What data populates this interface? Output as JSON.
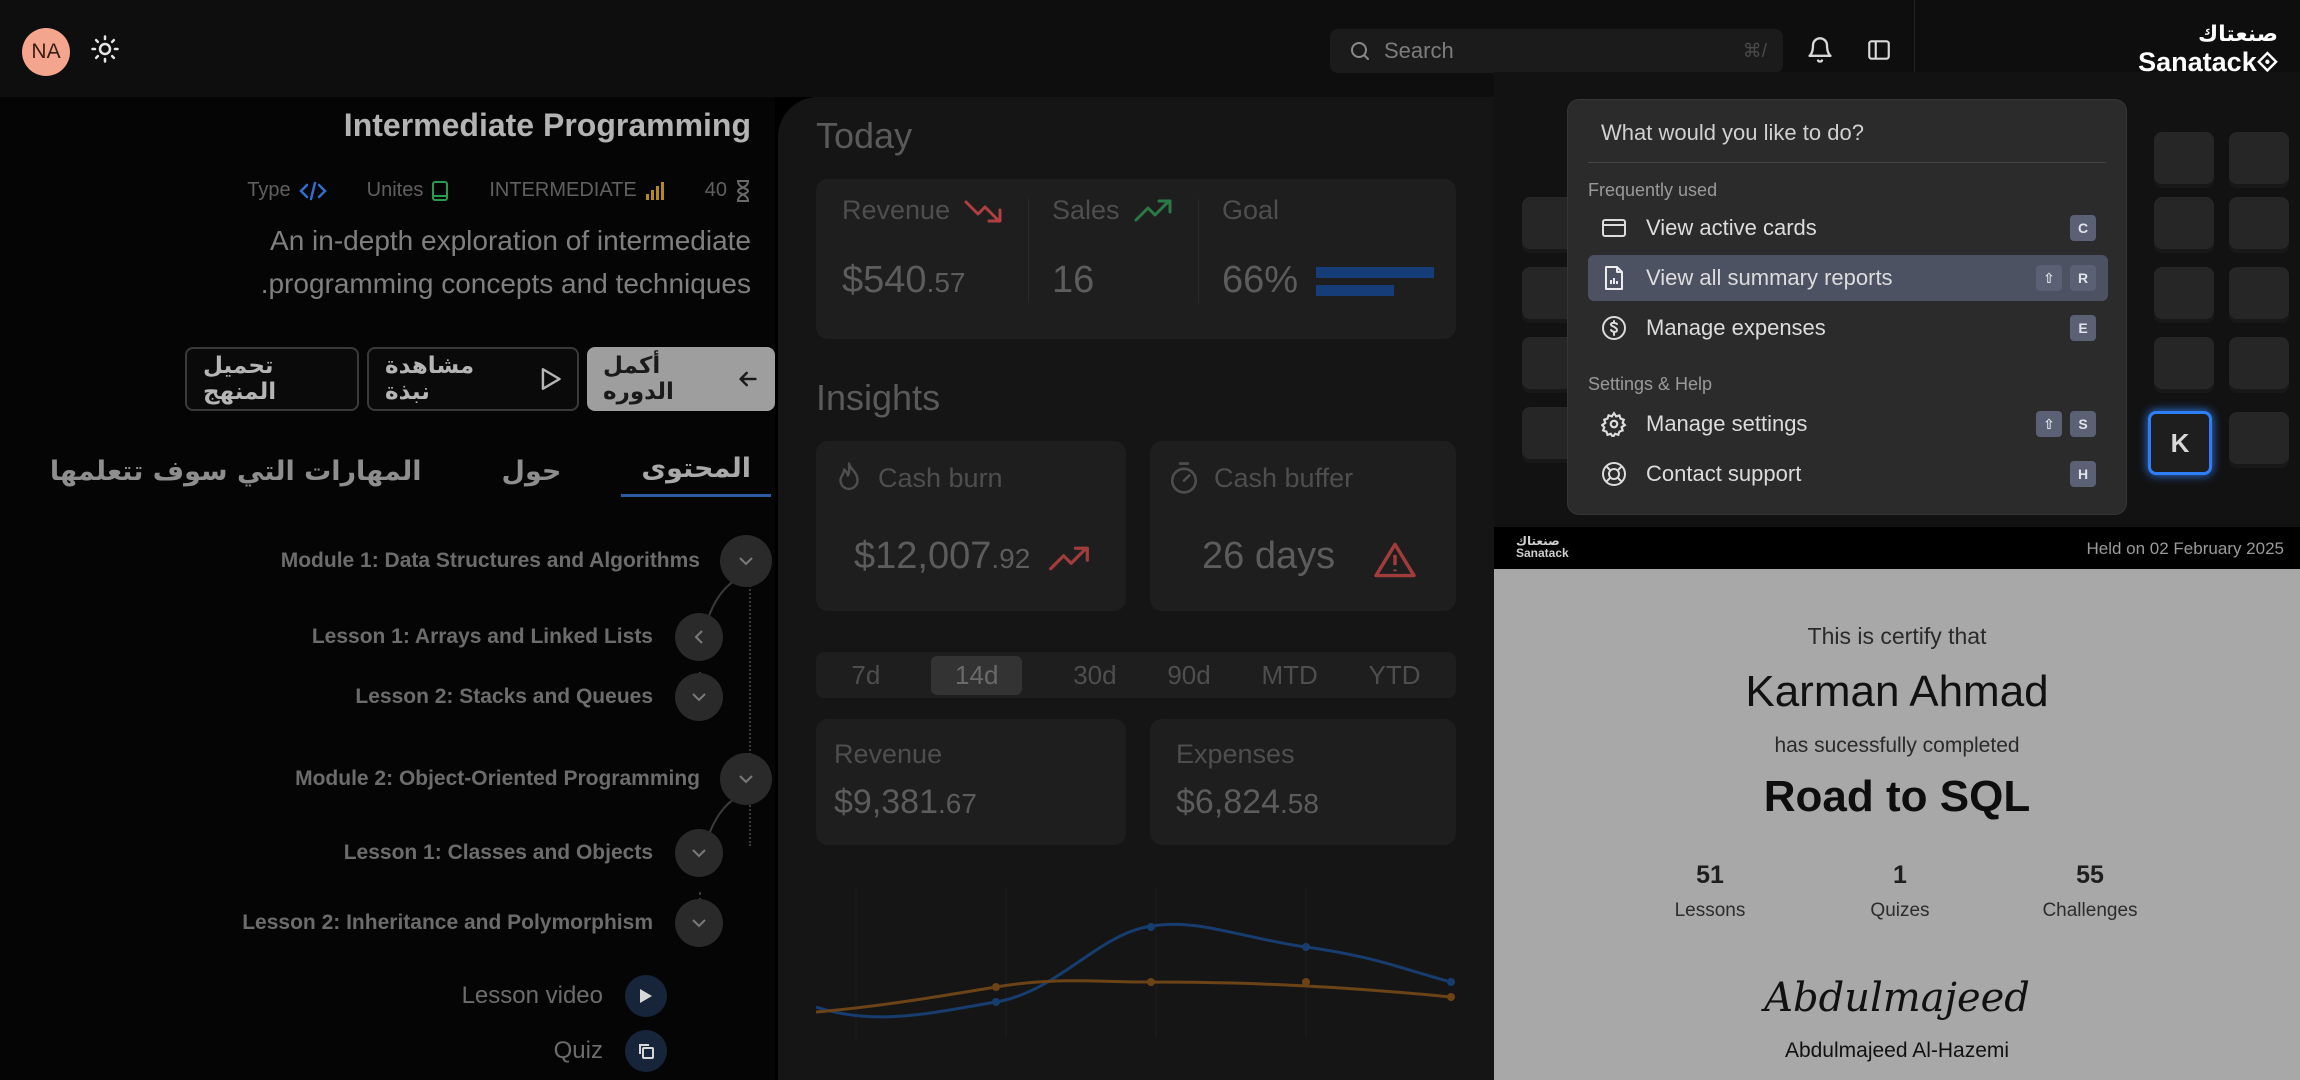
{
  "topbar": {
    "avatar_initials": "NA",
    "search_placeholder": "Search",
    "search_shortcut": "⌘/",
    "brand_ar": "صنعتاك",
    "brand_en": "Sanatack"
  },
  "course": {
    "title": "Intermediate Programming",
    "meta": [
      {
        "label": "Type",
        "icon": "code-icon"
      },
      {
        "label": "Unites",
        "icon": "book-icon"
      },
      {
        "label": "INTERMEDIATE",
        "icon": "signal-bars-icon"
      },
      {
        "label": "40",
        "icon": "hourglass-icon"
      }
    ],
    "description": "An in-depth exploration of intermediate programming concepts and techniques.",
    "description_line1": "An in-depth exploration of intermediate",
    "description_line2": ".programming concepts and techniques",
    "buttons": {
      "download": "تحميل المنهج",
      "preview": "مشاهدة نبذة",
      "continue": "أكمل الدوره"
    },
    "tabs": [
      "المحتوى",
      "حول",
      "المهارات التي سوف تتعلمها"
    ],
    "outline": {
      "module1": "Module 1: Data Structures and Algorithms",
      "m1_lesson1": "Lesson 1: Arrays and Linked Lists",
      "m1_lesson2": "Lesson 2: Stacks and Queues",
      "module2": "Module 2: Object-Oriented Programming",
      "m2_lesson1": "Lesson 1: Classes and Objects",
      "m2_lesson2": "Lesson 2: Inheritance and Polymorphism",
      "lesson_video": "Lesson video",
      "quiz": "Quiz"
    }
  },
  "dashboard": {
    "today_title": "Today",
    "revenue_label": "Revenue",
    "revenue_main": "$540",
    "revenue_cents": ".57",
    "sales_label": "Sales",
    "sales_value": "16",
    "goal_label": "Goal",
    "goal_value": "66%",
    "goal_fraction": 0.66,
    "insights_title": "Insights",
    "cash_burn_label": "Cash burn",
    "cash_burn_main": "$12,007",
    "cash_burn_cents": ".92",
    "cash_buffer_label": "Cash buffer",
    "cash_buffer_value": "26 days",
    "ranges": [
      "7d",
      "14d",
      "30d",
      "90d",
      "MTD",
      "YTD"
    ],
    "selected_range": "14d",
    "revenue2_label": "Revenue",
    "revenue2_main": "$9,381",
    "revenue2_cents": ".67",
    "expenses_label": "Expenses",
    "expenses_main": "$6,824",
    "expenses_cents": ".58",
    "colors": {
      "down": "#d94d4d",
      "up": "#2e9e52",
      "goal": "#1f5fb8",
      "line_blue": "#1f5fb8",
      "line_orange": "#b5701c"
    }
  },
  "palette": {
    "prompt": "What would you like to do?",
    "group1": "Frequently used",
    "items1": [
      {
        "label": "View active cards",
        "icon": "credit-card-icon",
        "keys": [
          "C"
        ]
      },
      {
        "label": "View all summary reports",
        "icon": "report-file-icon",
        "keys": [
          "⇧",
          "R"
        ]
      },
      {
        "label": "Manage expenses",
        "icon": "dollar-circle-icon",
        "keys": [
          "E"
        ]
      }
    ],
    "group2": "Settings & Help",
    "items2": [
      {
        "label": "Manage settings",
        "icon": "gear-icon",
        "keys": [
          "⇧",
          "S"
        ]
      },
      {
        "label": "Contact support",
        "icon": "lifebuoy-icon",
        "keys": [
          "H"
        ]
      }
    ],
    "highlight_key": "K"
  },
  "certificate": {
    "logo_ar": "صنعتاك",
    "logo_en": "Sanatack",
    "held": "Held on 02 February 2025",
    "certify": "This is certify that",
    "name": "Karman Ahmad",
    "completed": "has sucessfully completed",
    "course": "Road to SQL",
    "stats": [
      {
        "n": "51",
        "t": "Lessons"
      },
      {
        "n": "1",
        "t": "Quizes"
      },
      {
        "n": "55",
        "t": "Challenges"
      }
    ],
    "signature": "Abdulmajeed",
    "signer": "Abdulmajeed Al-Hazemi"
  }
}
